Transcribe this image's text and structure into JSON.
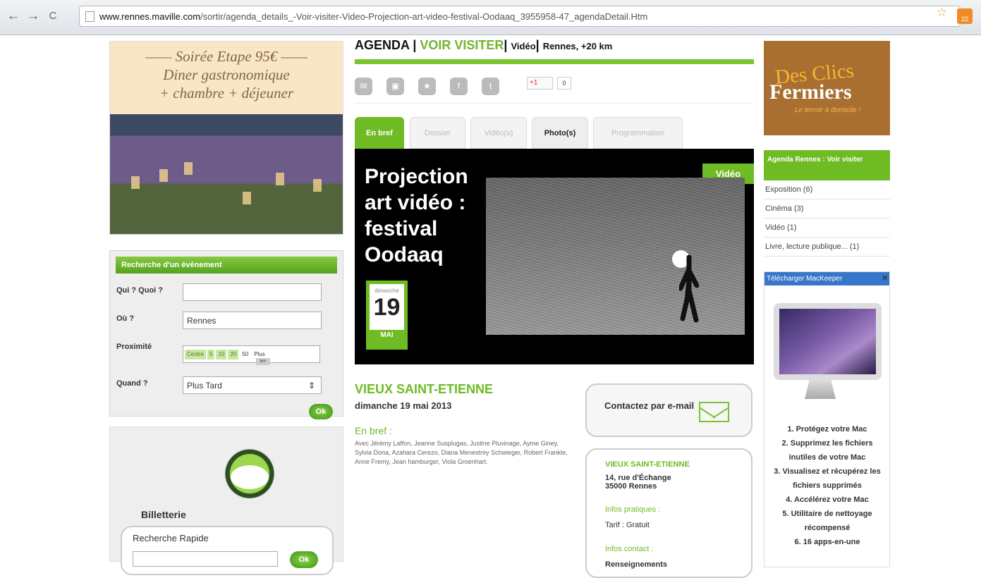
{
  "browser": {
    "back": "←",
    "forward": "→",
    "reload": "C",
    "url_domain": "www.rennes.maville.com",
    "url_path": "/sortir/agenda_details_-Voir-visiter-Video-Projection-art-video-festival-Oodaaq_3955958-47_agendaDetail.Htm",
    "rss_count": "22"
  },
  "hotel_ad": {
    "line1": "—— Soirée Etape 95€ ——",
    "line2": "Diner gastronomique",
    "line3": "+ chambre + déjeuner"
  },
  "search": {
    "title": "Recherche d'un événement",
    "who_label": "Qui ? Quoi ?",
    "where_label": "Où ?",
    "where_value": "Rennes",
    "proximity_label": "Proximité",
    "proximity_options": [
      "Centre",
      "5",
      "10",
      "20",
      "50",
      "Plus"
    ],
    "proximity_indicator": "km",
    "when_label": "Quand ?",
    "when_value": "Plus Tard",
    "ok": "Ok"
  },
  "ticketing": {
    "title": "Billetterie",
    "quick_search": "Recherche Rapide",
    "ok": "Ok"
  },
  "breadcrumb": {
    "agenda": "AGENDA",
    "voir": "VOIR VISITER",
    "video": "Vidéo",
    "location": "Rennes, +20 km"
  },
  "share": {
    "gplus": "+1",
    "count": "0"
  },
  "tabs": [
    "En bref",
    "Dossier",
    "Vidéo(s)",
    "Photo(s)",
    "Programmation"
  ],
  "hero": {
    "title": "Projection art vidéo : festival Oodaaq",
    "badge": "Vidéo",
    "dow": "dimanche",
    "day": "19",
    "month": "MAI"
  },
  "event": {
    "place": "VIEUX SAINT-ETIENNE",
    "date": "dimanche 19 mai 2013",
    "brief_title": "En bref :",
    "brief": "Avec Jérémy Laffon, Jeanne Susplugas, Justine Pluvinage, Ayme Giney, Sylvia Dona, Azahara Cerezo, Diana Menestrey Schwieger, Robert Frankle, Anne Fremy, Jean hamburger, Viola Groenhart."
  },
  "contact": {
    "title": "Contactez par e-mail"
  },
  "info": {
    "place": "VIEUX SAINT-ETIENNE",
    "address1": "14, rue d'Échange",
    "address2": "35000 Rennes",
    "practical": "Infos pratiques :",
    "tariff": "Tarif : Gratuit",
    "contact": "Infos contact :",
    "details": "Renseignements"
  },
  "right": {
    "ad_line1": "Des Clics",
    "ad_line2": "Fermiers",
    "ad_line3": "Le terroir à domicile !",
    "agenda_title": "Agenda Rennes : Voir visiter",
    "agenda_items": [
      "Exposition (6)",
      "Cinéma (3)",
      "Vidéo (1)",
      "Livre, lecture publique... (1)"
    ],
    "mackeeper_title": "Télécharger MacKeeper",
    "mackeeper_items": [
      "1. Protégez votre Mac",
      "2. Supprimez les fichiers inutiles de votre Mac",
      "3. Visualisez et récupérez les fichiers supprimés",
      "4. Accélérez votre Mac",
      "5. Utilitaire de nettoyage récompensé",
      "6. 16 apps-en-une"
    ]
  }
}
